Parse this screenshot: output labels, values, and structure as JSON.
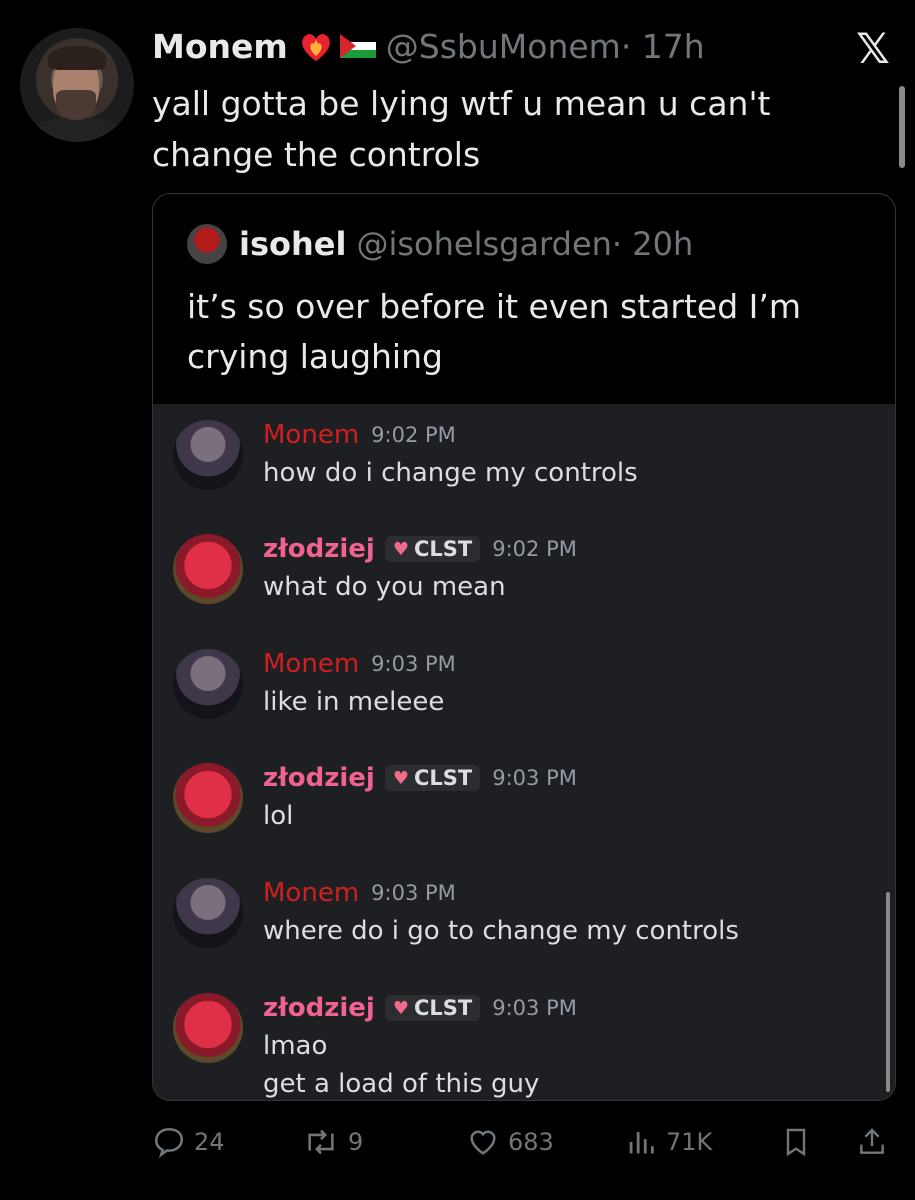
{
  "tweet": {
    "author_name": "Monem",
    "handle": "@SsbuMonem",
    "time": "· 17h",
    "text": "yall gotta be lying wtf u mean u can't change the controls"
  },
  "quote": {
    "author_name": "isohel",
    "handle": "@isohelsgarden",
    "time": "· 20h",
    "text": "it’s so over before it even started I’m crying laughing"
  },
  "chat": {
    "messages": [
      {
        "user": "Monem",
        "time": "9:02 PM",
        "text": "how do i change my controls"
      },
      {
        "user": "złodziej",
        "tag": "CLST",
        "time": "9:02 PM",
        "text": "what do you mean"
      },
      {
        "user": "Monem",
        "time": "9:03 PM",
        "text": "like in meleee"
      },
      {
        "user": "złodziej",
        "tag": "CLST",
        "time": "9:03 PM",
        "text": "lol"
      },
      {
        "user": "Monem",
        "time": "9:03 PM",
        "text": "where do i go to change my controls"
      },
      {
        "user": "złodziej",
        "tag": "CLST",
        "time": "9:03 PM",
        "text": "lmao",
        "text2": "get a load of this guy"
      }
    ]
  },
  "actions": {
    "replies": "24",
    "reposts": "9",
    "likes": "683",
    "views": "71K"
  },
  "colors": {
    "monem": "#d11f1f",
    "zlodziej": "#f06292",
    "chat_bg": "#1e1f22"
  }
}
